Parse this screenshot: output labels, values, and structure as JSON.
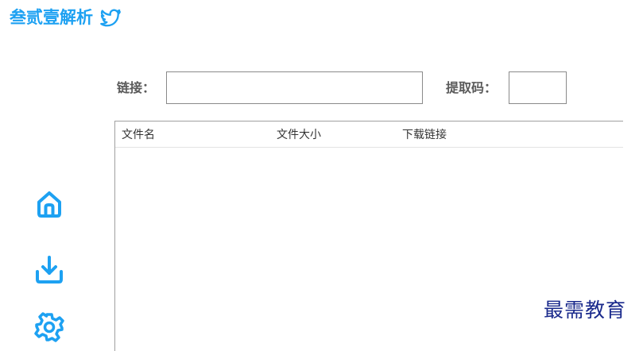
{
  "app": {
    "title": "叁贰壹解析",
    "accent_color": "#1da1f2",
    "title_icon": "twitter-bird-icon"
  },
  "form": {
    "link_label": "链接：",
    "link_value": "",
    "code_label": "提取码：",
    "code_value": ""
  },
  "table": {
    "columns": [
      "文件名",
      "文件大小",
      "下载链接"
    ],
    "rows": []
  },
  "nav": {
    "icons": [
      "home-icon",
      "download-icon",
      "settings-icon"
    ]
  },
  "watermark": {
    "text": "最需教育",
    "color": "#1a2a8c"
  }
}
